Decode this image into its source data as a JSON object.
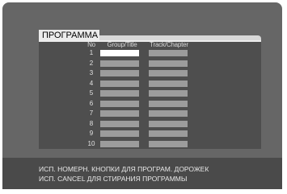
{
  "title": "ПРОГРАММА",
  "columns": {
    "no": "No",
    "group": "Group/Title",
    "track": "Track/Chapter"
  },
  "rows": [
    {
      "no": "1",
      "selected": true
    },
    {
      "no": "2"
    },
    {
      "no": "3"
    },
    {
      "no": "4"
    },
    {
      "no": "5"
    },
    {
      "no": "6"
    },
    {
      "no": "7"
    },
    {
      "no": "8"
    },
    {
      "no": "9"
    },
    {
      "no": "10"
    }
  ],
  "messages": [
    "ИСП. НОМЕРН. КНОПКИ ДЛЯ ПРОГРАМ. ДОРОЖЕК",
    "ИСП. CANCEL ДЛЯ СТИРАНИЯ ПРОГРАММЫ"
  ],
  "colors": {
    "background": "#666666",
    "panel": "#4e4e4e",
    "cell": "#9c9c9c",
    "selected_cell": "#ffffff"
  }
}
